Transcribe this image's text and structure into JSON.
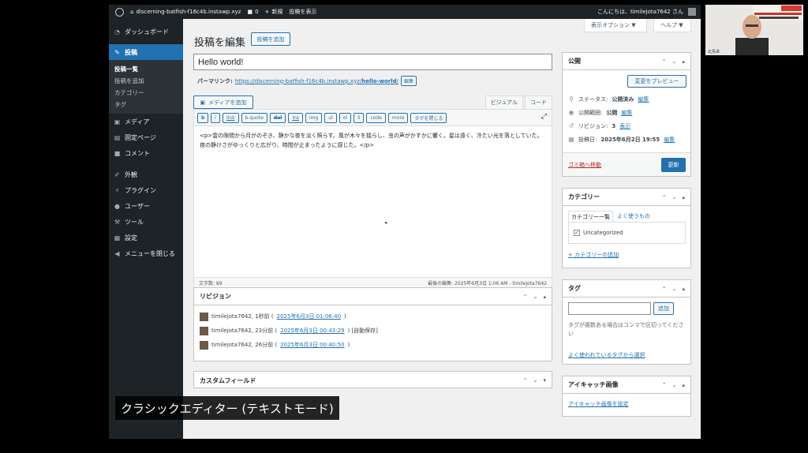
{
  "admin_bar": {
    "site": "discerning-batfish-f16c4b.instawp.xyz",
    "comments_count": "0",
    "new": "新規",
    "view_post": "投稿を表示",
    "howdy": "こんにちは、timilejota7642 さん"
  },
  "sidebar": {
    "dashboard": "ダッシュボード",
    "posts": "投稿",
    "submenu": [
      "投稿一覧",
      "投稿を追加",
      "カテゴリー",
      "タグ"
    ],
    "items": [
      "メディア",
      "固定ページ",
      "コメント",
      "外観",
      "プラグイン",
      "ユーザー",
      "ツール",
      "設定",
      "メニューを閉じる"
    ]
  },
  "header": {
    "screen_options": "表示オプション ▼",
    "help": "ヘルプ ▼",
    "page_title": "投稿を編集",
    "add_new": "投稿を追加"
  },
  "post": {
    "title": "Hello world!",
    "permalink_label": "パーマリンク:",
    "permalink_url_base": "https://discerning-batfish-f16c4b.instawp.xyz/",
    "permalink_slug": "hello-world",
    "permalink_trailing": "/",
    "edit_permalink": "編集"
  },
  "editor": {
    "add_media": "メディアを追加",
    "tab_visual": "ビジュアル",
    "tab_code": "コード",
    "quicktags": [
      "b",
      "i",
      "link",
      "b-quote",
      "del",
      "ins",
      "img",
      "ul",
      "ol",
      "li",
      "code",
      "more",
      "タグを閉じる"
    ],
    "content": "<p>雲の隙間から月がのぞき、静かな夜を淡く照らす。風が木々を揺らし、虫の声がかすかに響く。星は遠く、冷たい光を落としていた。夜の静けさがゆっくりと広がり、時間が止まったように感じた。</p>",
    "word_count": "文字数: 89",
    "last_edited": "最後の編集: 2025年6月3日 1:06 AM - timilejota7642"
  },
  "revisions": {
    "title": "リビジョン",
    "rows": [
      {
        "user": "timilejota7642, 1秒前 (",
        "link": "2025年6月3日 01:06:40",
        "tail": ")"
      },
      {
        "user": "timilejota7642, 23分前 (",
        "link": "2025年6月3日 00:43:29",
        "tail": ") [自動保存]"
      },
      {
        "user": "timilejota7642, 26分前 (",
        "link": "2025年6月3日 00:40:50",
        "tail": ")"
      }
    ]
  },
  "custom_fields": {
    "title": "カスタムフィールド"
  },
  "publish": {
    "title": "公開",
    "preview": "変更をプレビュー",
    "status_label": "ステータス:",
    "status_value": "公開済み",
    "visibility_label": "公開範囲:",
    "visibility_value": "公開",
    "revisions_label": "リビジョン:",
    "revisions_value": "3",
    "revisions_link": "表示",
    "published_label": "投稿日:",
    "published_value": "2025年6月2日 19:55",
    "edit": "編集",
    "trash": "ゴミ箱へ移動",
    "update": "更新"
  },
  "categories": {
    "title": "カテゴリー",
    "tab_all": "カテゴリー一覧",
    "tab_popular": "よく使うもの",
    "item": "Uncategorized",
    "add_new": "+ カテゴリーの追加"
  },
  "tags": {
    "title": "タグ",
    "add": "追加",
    "help": "タグが複数ある場合はコンマで区切ってください",
    "choose": "よく使われているタグから選択"
  },
  "featured_image": {
    "title": "アイキャッチ画像",
    "set": "アイキャッチ画像を設定"
  },
  "caption": "クラシックエディター (テキストモード)",
  "webcam": {
    "name": "北島卓"
  },
  "colors": {
    "accent": "#2271b1",
    "admin_dark": "#1d2327",
    "trash": "#b32d2e"
  }
}
